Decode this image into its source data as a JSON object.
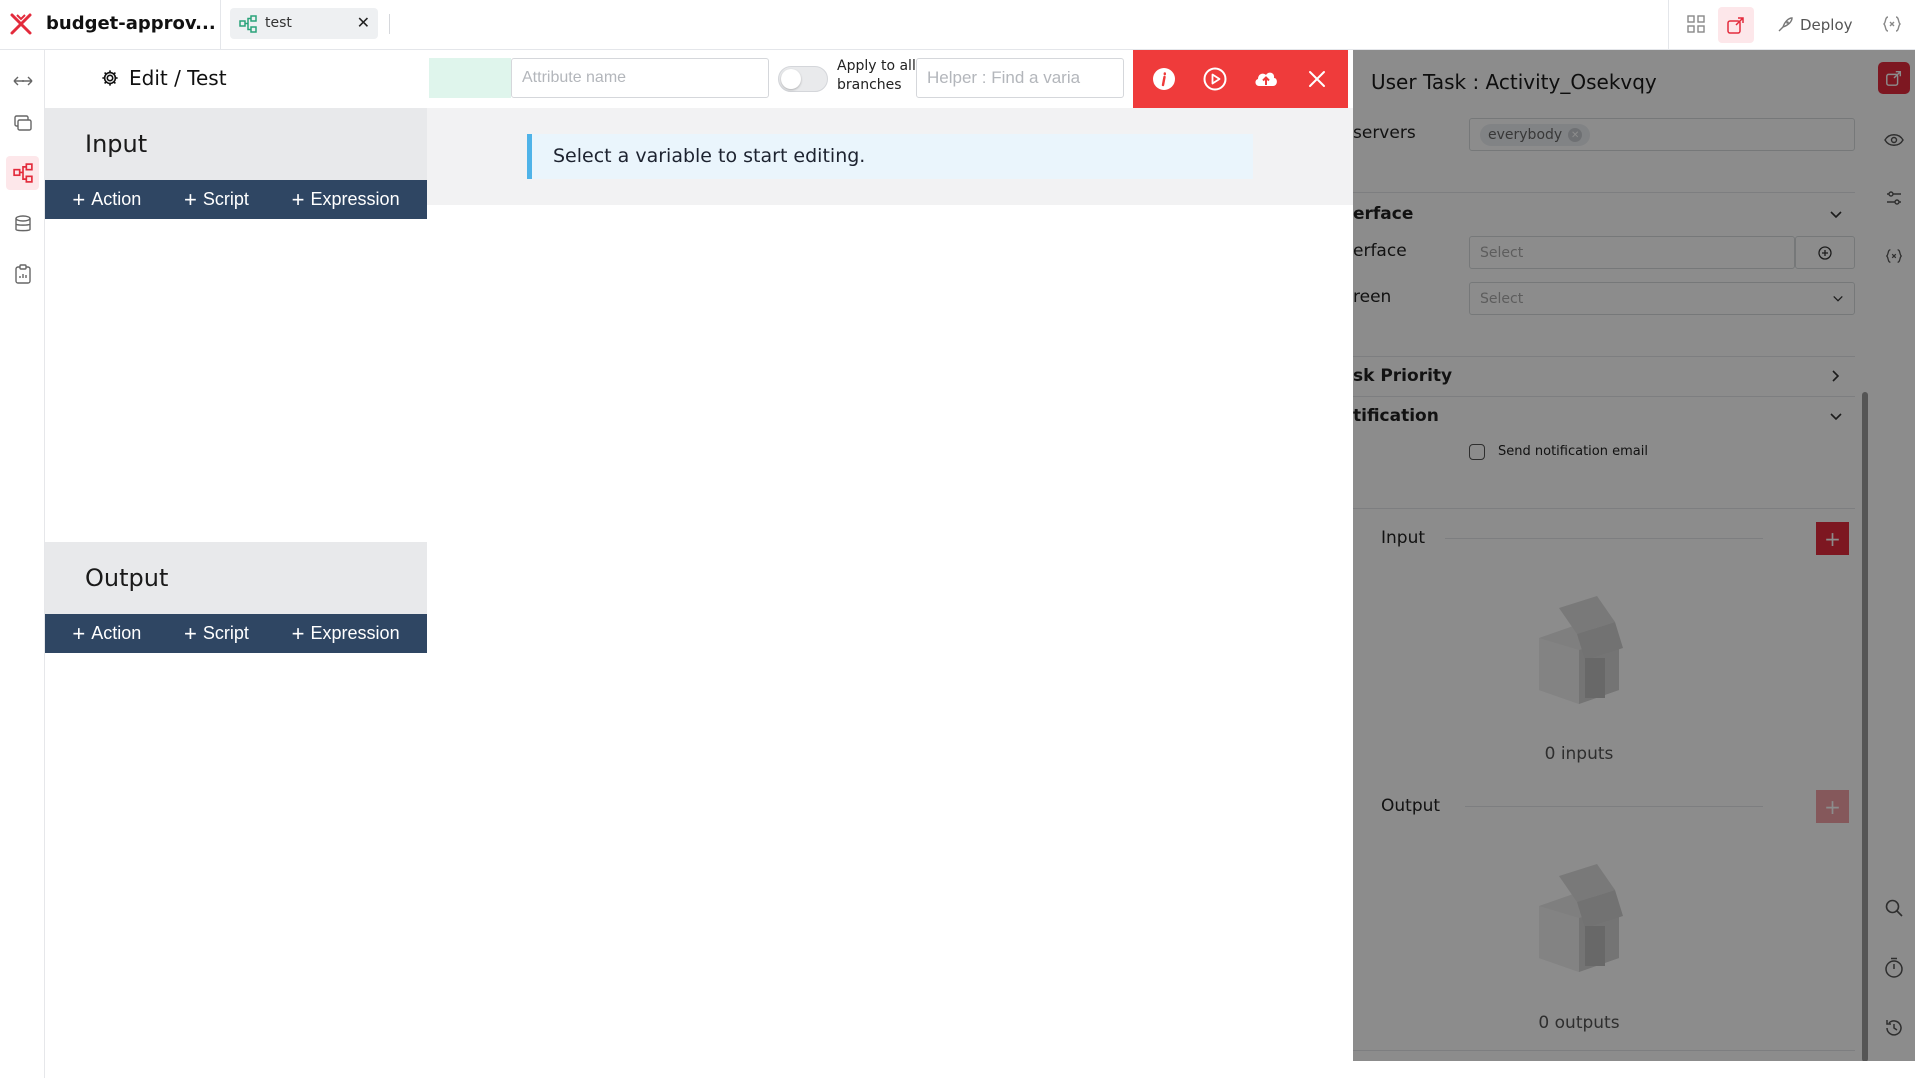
{
  "colors": {
    "accent_red": "#ef3b3b",
    "navy": "#2f4663",
    "info_blue": "#4fb3e8",
    "mint": "#dff5ec"
  },
  "topbar": {
    "app_title": "budget-approv...",
    "tab": {
      "label": "test",
      "icon": "workflow-icon",
      "close_icon": "close-icon"
    },
    "right": {
      "icons": [
        "grid-icon",
        "export-icon",
        "variable-icon"
      ],
      "deploy_label": "Deploy",
      "deploy_icon": "rocket-icon"
    }
  },
  "left_rail": {
    "items": [
      "arrows-icon",
      "layers-icon",
      "workflow-icon",
      "database-icon",
      "clipboard-icon"
    ],
    "active": "workflow-icon"
  },
  "editor": {
    "title": "Edit / Test",
    "attribute_placeholder": "Attribute name",
    "apply_label": "Apply to all branches",
    "helper_placeholder": "Helper : Find a varia",
    "toolbar_icons": [
      "info-icon",
      "play-icon",
      "upload-icon",
      "close-icon"
    ],
    "info_message": "Select a variable to start editing."
  },
  "io": {
    "input": {
      "title": "Input",
      "buttons": [
        "Action",
        "Script",
        "Expression"
      ]
    },
    "output": {
      "title": "Output",
      "buttons": [
        "Action",
        "Script",
        "Expression"
      ]
    }
  },
  "right_panel": {
    "title": "User Task : Activity_Osekvqy",
    "observers_label": "servers",
    "observers_chip": "everybody",
    "interface_section": "erface",
    "interface_label": "erface",
    "interface_placeholder": "Select",
    "screen_label": "reen",
    "screen_placeholder": "Select",
    "priority_section": "sk Priority",
    "notification_section": "tification",
    "send_notification": "Send notification email",
    "input_label": "Input",
    "inputs_empty": "0 inputs",
    "output_label": "Output",
    "outputs_empty": "0 outputs"
  },
  "right_rail": {
    "items": [
      "export-icon",
      "eye-icon",
      "sliders-icon",
      "variable-icon",
      "search-icon",
      "timer-icon",
      "history-icon"
    ]
  }
}
